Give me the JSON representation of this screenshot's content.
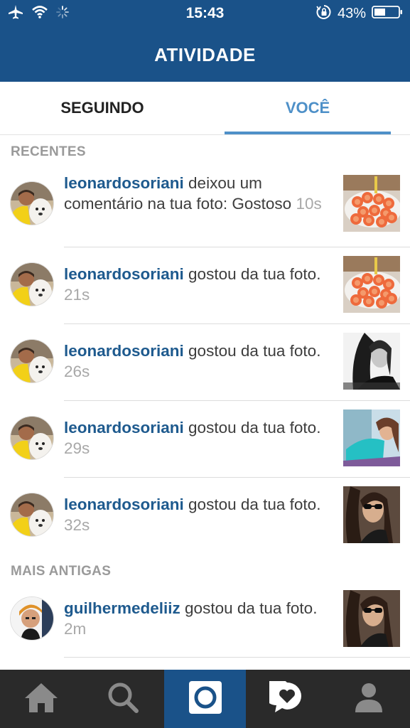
{
  "status_bar": {
    "time": "15:43",
    "battery_percent": "43%",
    "icons": [
      "airplane-icon",
      "wifi-icon",
      "activity-spinner-icon",
      "orientation-lock-icon",
      "battery-icon"
    ]
  },
  "nav": {
    "title": "ATIVIDADE"
  },
  "tabs": [
    {
      "label": "SEGUINDO",
      "active": false
    },
    {
      "label": "VOCÊ",
      "active": true
    }
  ],
  "sections": {
    "recent": "RECENTES",
    "older": "MAIS ANTIGAS"
  },
  "recent_items": [
    {
      "username": "leonardosoriani",
      "action": " deixou um comentário na tua foto: Gostoso ",
      "time": "10s",
      "thumb": "food"
    },
    {
      "username": "leonardosoriani",
      "action": " gostou da tua foto. ",
      "time": "21s",
      "thumb": "food"
    },
    {
      "username": "leonardosoriani",
      "action": " gostou da tua foto. ",
      "time": "26s",
      "thumb": "bw-portrait"
    },
    {
      "username": "leonardosoriani",
      "action": " gostou da tua foto. ",
      "time": "29s",
      "thumb": "teal-portrait"
    },
    {
      "username": "leonardosoriani",
      "action": " gostou da tua foto. ",
      "time": "32s",
      "thumb": "sunglasses-portrait"
    }
  ],
  "older_items": [
    {
      "username": "guilhermedeliiz",
      "action": " gostou da tua foto. ",
      "time": "2m",
      "thumb": "sunglasses-portrait"
    }
  ],
  "tab_bar": [
    {
      "icon": "home-icon",
      "active": false
    },
    {
      "icon": "search-icon",
      "active": false
    },
    {
      "icon": "camera-icon",
      "active": true
    },
    {
      "icon": "activity-heart-icon",
      "active": false
    },
    {
      "icon": "profile-icon",
      "active": false
    }
  ],
  "colors": {
    "header_blue": "#1a5289",
    "accent_blue": "#4e90c8",
    "username_blue": "#1e5a8e",
    "tab_bar_dark": "#2a2a2a"
  }
}
